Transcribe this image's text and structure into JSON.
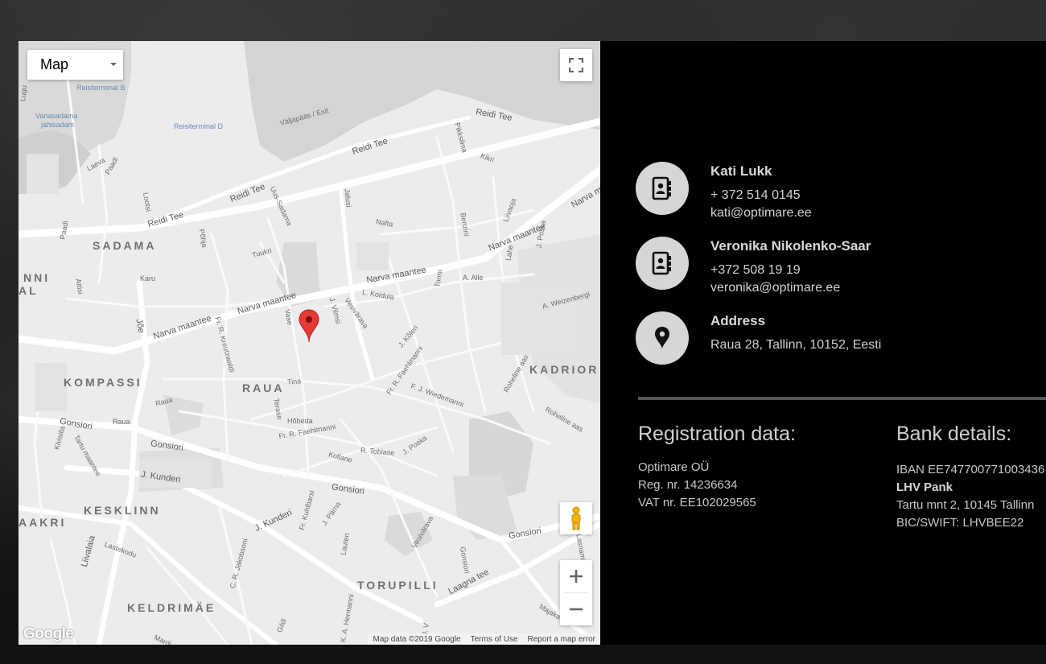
{
  "map": {
    "type_control": "Map",
    "google_logo": "Google",
    "attribution": [
      "Map data ©2019 Google",
      "Terms of Use",
      "Report a map error"
    ],
    "districts": [
      "SADAMA",
      "KOMPASSI",
      "RAUA",
      "KADRIOR",
      "KESKLINN",
      "TORUPILLI",
      "KELDRIMÄE",
      "NNI",
      "AL",
      "AAKRI"
    ],
    "streets": {
      "reidi_tee_1": "Reidi Tee",
      "reidi_tee_2": "Reidi Tee",
      "reidi_tee_3": "Reidi Tee",
      "reidi_tee_4": "Reidi Tee",
      "narva_1": "Narva maantee",
      "narva_2": "Narva maantee",
      "narva_3": "Narva maantee",
      "narva_4": "Narva maantee",
      "gonsiori_1": "Gonsiori",
      "gonsiori_2": "Gonsiori",
      "gonsiori_3": "Gonsiori",
      "gonsiori_4": "Gonsiori",
      "kunderi_1": "J. Kunderi",
      "kunderi_2": "J. Kunderi",
      "laagna": "Laagna tee",
      "joe": "Jõe",
      "liivalaia": "Liivalaia",
      "uus_sadama": "Uus-Sadama",
      "kreutzwaldi": "Fr. R. Kreutzwaldi",
      "vilmsi": "J. Vilmsi",
      "faehlmanni_1": "Fr. R. Faehlmanni",
      "faehlmanni_2": "Fr. R. Faehlmanni",
      "wiedemanni": "F. J. Wiedemanni",
      "poska_1": "J. Poska",
      "poska_2": "J. Poska",
      "raua_1": "Raua",
      "raua_2": "Raua",
      "tina": "Tina",
      "vase": "Vase",
      "hobeda": "Hõbeda",
      "terase": "Terase",
      "tobiase": "R. Tobiase",
      "kollane": "Kollane",
      "koidula": "L. Koidula",
      "kolleri": "J. Kõleri",
      "vesivarava_1": "Vesivärava",
      "vesivarava_2": "Vesivärava",
      "nafta": "Nafta",
      "tuukri": "Tuukri",
      "karu": "Karu",
      "a_alle": "A. Alle",
      "tormi": "Tormi",
      "benzini": "Benzini",
      "liivaoja": "Liivaoja",
      "lahe": "Lahe",
      "kilikk": "Pikksilma",
      "kikri": "Kikri",
      "weizenbergi": "A. Weizenbergi",
      "roheline_1": "Roheline aas",
      "roheline_2": "Roheline aas",
      "valjapaas": "Väljapääs / Exit",
      "laeva": "Laeva",
      "paadi_1": "Paadi",
      "paadi_2": "Paadi",
      "lootsi": "Lootsi",
      "pohja": "Põhja",
      "jaluse": "Jalusi",
      "attisi": "Attisi",
      "kivisilla": "Kivisilla",
      "tartu": "Tartu maantee",
      "lastekodu": "Lastekodu",
      "jakobsoni": "C. R. Jakobsoni",
      "kuhlbarsi": "Fr. Kuhlbarsi",
      "pärna": "J. Pärna",
      "lauteri": "Lauteri",
      "hermanni": "K. A. Hermanni",
      "gildi": "Gildi",
      "mardi": "Mardi",
      "majaka": "Majaka",
      "lasnamae": "Lasnamäe",
      "jv": "J. V",
      "tehnika": "Gonsiori",
      "jooe": "Lugu"
    },
    "pois": {
      "reisiterminal_b": "Reisiterminal B",
      "reisiterminal_d": "Reisiterminal D",
      "vanasadama_1": "Vanasadama",
      "vanasadama_2": "jahisadam"
    },
    "marker_color": "#e53935"
  },
  "contacts": [
    {
      "name": "Kati Lukk",
      "line1": "+ 372  514 0145",
      "line2": "kati@optimare.ee",
      "icon": "contact-book-icon"
    },
    {
      "name": "Veronika Nikolenko-Saar",
      "line1": "+372 508 19 19",
      "line2": "veronika@optimare.ee",
      "icon": "contact-book-icon"
    },
    {
      "name": "Address",
      "line1": "Raua 28, Tallinn, 10152, Eesti",
      "icon": "location-pin-icon"
    }
  ],
  "registration": {
    "heading": "Registration data:",
    "lines": [
      "Optimare OÜ",
      "Reg. nr. 14236634",
      "VAT nr. EE102029565"
    ]
  },
  "bank": {
    "heading": "Bank details:",
    "iban": "IBAN EE747700771003436",
    "bank_name": "LHV Pank",
    "address": "Tartu mnt 2, 10145 Tallinn",
    "bic": "BIC/SWIFT: LHVBEE22"
  }
}
